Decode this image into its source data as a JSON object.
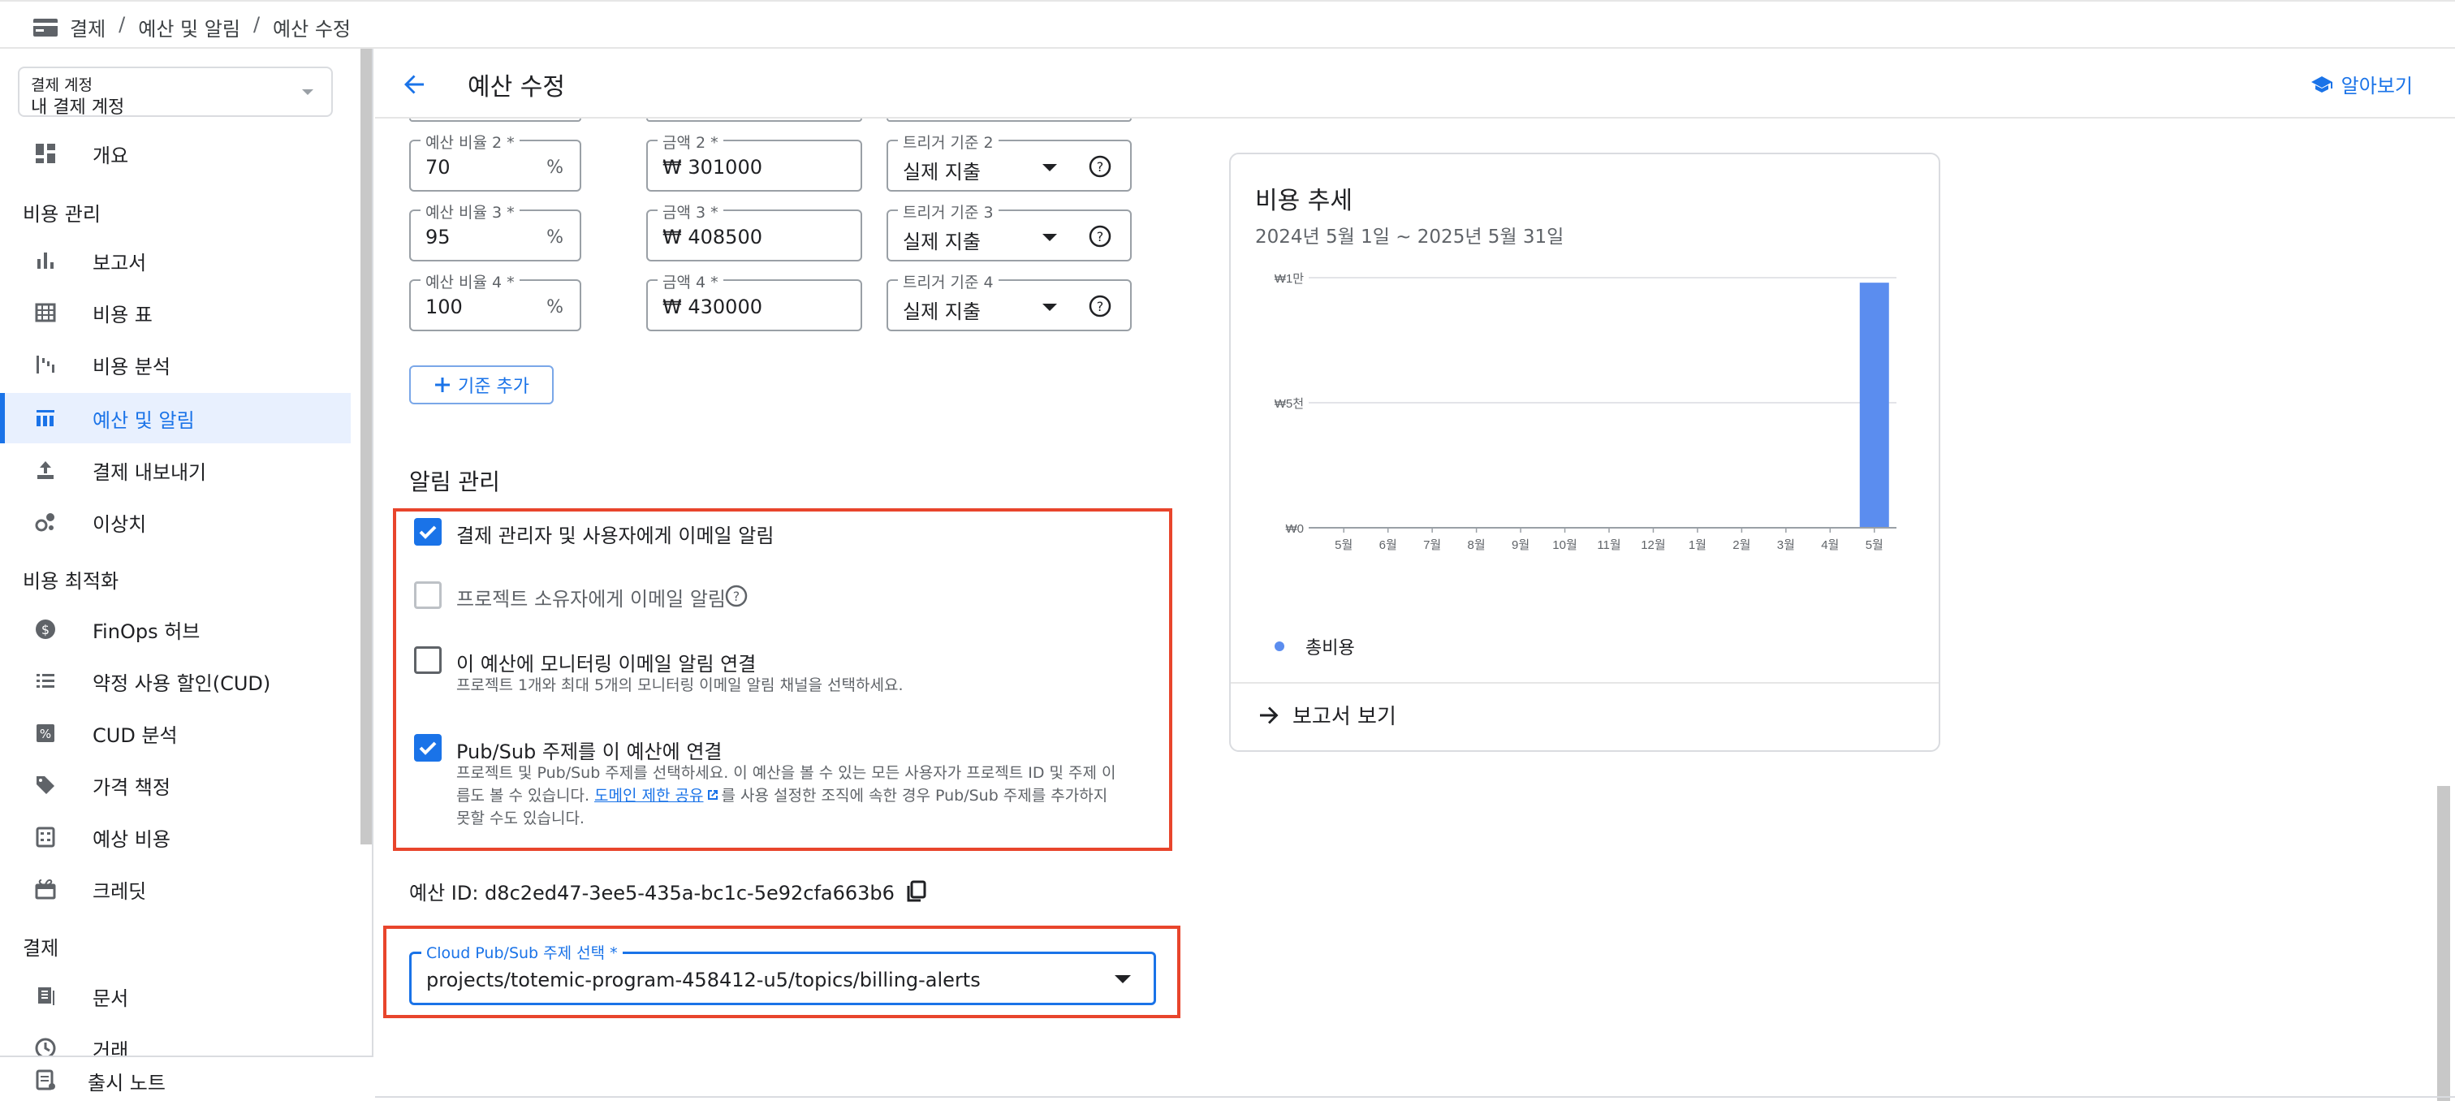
{
  "breadcrumb": [
    "결제",
    "예산 및 알림",
    "예산 수정"
  ],
  "account": {
    "label": "결제 계정",
    "value": "내 결제 계정"
  },
  "nav": {
    "overview": "개요",
    "section_cost": "비용 관리",
    "reports": "보고서",
    "cost_table": "비용 표",
    "cost_analysis": "비용 분석",
    "budgets": "예산 및 알림",
    "export": "결제 내보내기",
    "anomalies": "이상치",
    "section_opt": "비용 최적화",
    "finops": "FinOps 허브",
    "cud": "약정 사용 할인(CUD)",
    "cud_analysis": "CUD 분석",
    "pricing": "가격 책정",
    "forecast": "예상 비용",
    "credits": "크레딧",
    "section_billing": "결제",
    "documents": "문서",
    "transactions": "거래",
    "release_notes": "출시 노트"
  },
  "header": {
    "title": "예산 수정",
    "learn": "알아보기"
  },
  "thresholds": [
    {
      "pct_label": "예산 비율 2 *",
      "pct": "70",
      "amt_label": "금액 2 *",
      "amt": "₩ 301000",
      "trig_label": "트리거 기준 2",
      "trig": "실제 지출"
    },
    {
      "pct_label": "예산 비율 3 *",
      "pct": "95",
      "amt_label": "금액 3 *",
      "amt": "₩ 408500",
      "trig_label": "트리거 기준 3",
      "trig": "실제 지출"
    },
    {
      "pct_label": "예산 비율 4 *",
      "pct": "100",
      "amt_label": "금액 4 *",
      "amt": "₩ 430000",
      "trig_label": "트리거 기준 4",
      "trig": "실제 지출"
    }
  ],
  "pct_suffix": "%",
  "add_threshold": "기준 추가",
  "alerts": {
    "title": "알림 관리",
    "opt1": {
      "label": "결제 관리자 및 사용자에게 이메일 알림",
      "checked": true
    },
    "opt2": {
      "label": "프로젝트 소유자에게 이메일 알림",
      "checked": false
    },
    "opt3": {
      "label": "이 예산에 모니터링 이메일 알림 연결",
      "sub": "프로젝트 1개와 최대 5개의 모니터링 이메일 알림 채널을 선택하세요.",
      "checked": false
    },
    "opt4": {
      "label": "Pub/Sub 주제를 이 예산에 연결",
      "sub1": "프로젝트 및 Pub/Sub 주제를 선택하세요. 이 예산을 볼 수 있는 모든 사용자가 프로젝트 ID 및 주제 이",
      "sub2a": "름도 볼 수 있습니다. ",
      "sub2link": "도메인 제한 공유",
      "sub2b": "를 사용 설정한 조직에 속한 경우 Pub/Sub 주제를 추가하지",
      "sub3": "못할 수도 있습니다.",
      "checked": true
    }
  },
  "budget_id": "예산 ID: d8c2ed47-3ee5-435a-bc1c-5e92cfa663b6",
  "pubsub": {
    "label": "Cloud Pub/Sub 주제 선택 *",
    "value": "projects/totemic-program-458412-u5/topics/billing-alerts"
  },
  "card": {
    "title": "비용 추세",
    "subtitle": "2024년 5월 1일 ~ 2025년 5월 31일",
    "report_link": "보고서 보기"
  },
  "chart_data": {
    "type": "bar",
    "categories": [
      "5월",
      "6월",
      "7월",
      "8월",
      "9월",
      "10월",
      "11월",
      "12월",
      "1월",
      "2월",
      "3월",
      "4월",
      "5월"
    ],
    "series": [
      {
        "name": "총비용",
        "values": [
          0,
          0,
          0,
          0,
          0,
          0,
          0,
          0,
          0,
          0,
          0,
          0,
          9800
        ],
        "color": "#5b8def"
      }
    ],
    "yticks": [
      "₩0",
      "₩5천",
      "₩1만"
    ],
    "ylim": [
      0,
      10000
    ],
    "grid": true,
    "legend": "bottom-left"
  },
  "colors": {
    "accent": "#1a73e8",
    "highlight": "#e8452c",
    "bar": "#5b8def"
  }
}
